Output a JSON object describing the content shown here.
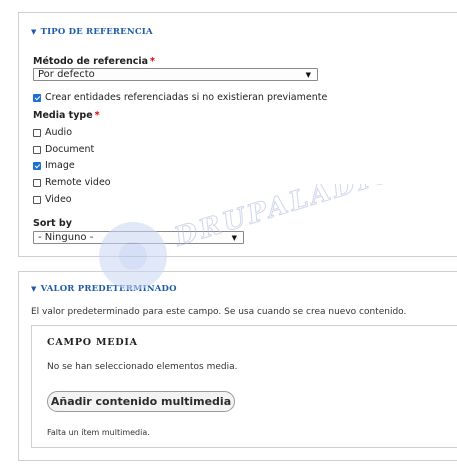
{
  "reference_type": {
    "legend": "TIPO DE REFERENCIA",
    "method_label": "Método de referencia",
    "required_mark": "*",
    "method_value": "Por defecto",
    "create_entities_label": "Crear entidades referenciadas si no existieran previamente",
    "create_entities_checked": true,
    "media_type_label": "Media type",
    "media_types": [
      {
        "label": "Audio",
        "checked": false
      },
      {
        "label": "Document",
        "checked": false
      },
      {
        "label": "Image",
        "checked": true
      },
      {
        "label": "Remote video",
        "checked": false
      },
      {
        "label": "Video",
        "checked": false
      }
    ],
    "sort_by_label": "Sort by",
    "sort_by_value": "- Ninguno -"
  },
  "default_value": {
    "legend": "VALOR PREDETERMINADO",
    "description": "El valor predeterminado para este campo. Se usa cuando se crea nuevo contenido.",
    "widget": {
      "title": "CAMPO MEDIA",
      "empty_message": "No se han seleccionado elementos media.",
      "add_button": "Añadir contenido multimedia",
      "footer": "Falta un ítem multimedia."
    }
  },
  "watermark": {
    "text": "DRUPALADICTO"
  },
  "colors": {
    "accent": "#1e5ba8",
    "required": "#e00000",
    "checkbox": "#1d6fd6"
  }
}
